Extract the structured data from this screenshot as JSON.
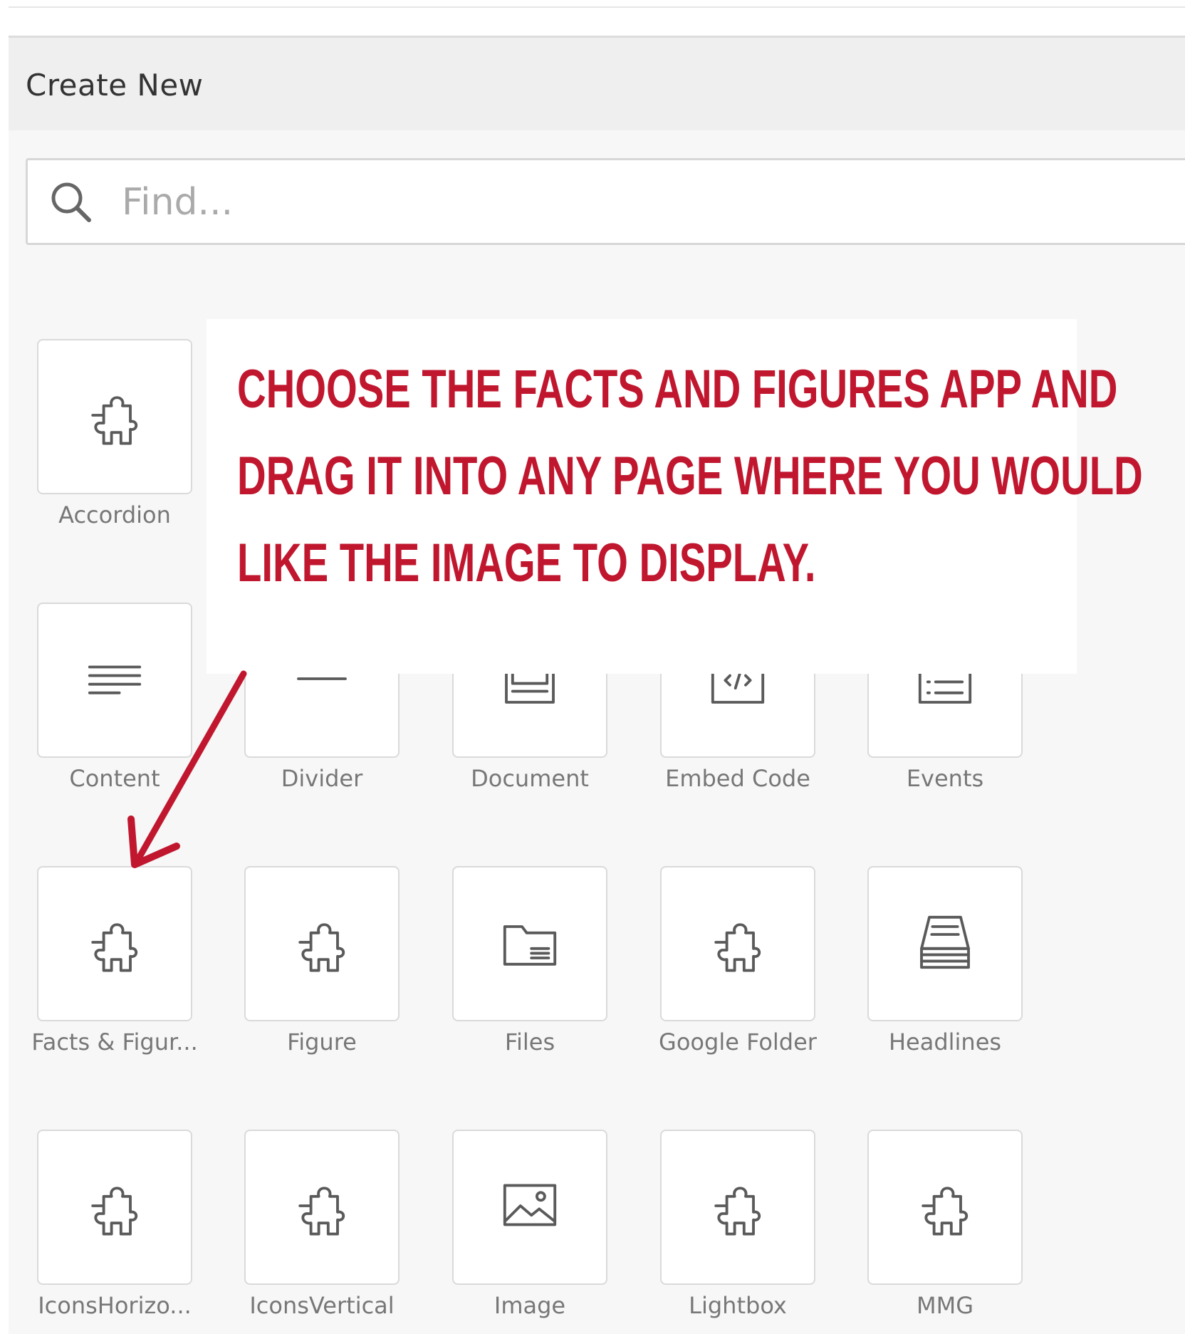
{
  "panel": {
    "title": "Create New"
  },
  "search": {
    "placeholder": "Find..."
  },
  "callout": {
    "lines": [
      "Choose the Facts and Figures app and",
      "drag it into any page where you would",
      "like the image to display."
    ]
  },
  "tiles": [
    {
      "label": "Accordion",
      "icon": "puzzle-icon"
    },
    {
      "label": "Content",
      "icon": "text-lines-icon"
    },
    {
      "label": "Divider",
      "icon": "divider-icon"
    },
    {
      "label": "Document",
      "icon": "document-icon"
    },
    {
      "label": "Embed Code",
      "icon": "code-icon"
    },
    {
      "label": "Events",
      "icon": "list-icon"
    },
    {
      "label": "Facts & Figur...",
      "icon": "puzzle-icon"
    },
    {
      "label": "Figure",
      "icon": "puzzle-icon"
    },
    {
      "label": "Files",
      "icon": "folder-icon"
    },
    {
      "label": "Google Folder",
      "icon": "puzzle-icon"
    },
    {
      "label": "Headlines",
      "icon": "stack-icon"
    },
    {
      "label": "IconsHorizo...",
      "icon": "puzzle-icon"
    },
    {
      "label": "IconsVertical",
      "icon": "puzzle-icon"
    },
    {
      "label": "Image",
      "icon": "image-icon"
    },
    {
      "label": "Lightbox",
      "icon": "puzzle-icon"
    },
    {
      "label": "MMG",
      "icon": "puzzle-icon"
    }
  ],
  "colors": {
    "callout_text": "#c0172f",
    "arrow": "#c0172f",
    "icon_stroke": "#5a5a5a"
  }
}
